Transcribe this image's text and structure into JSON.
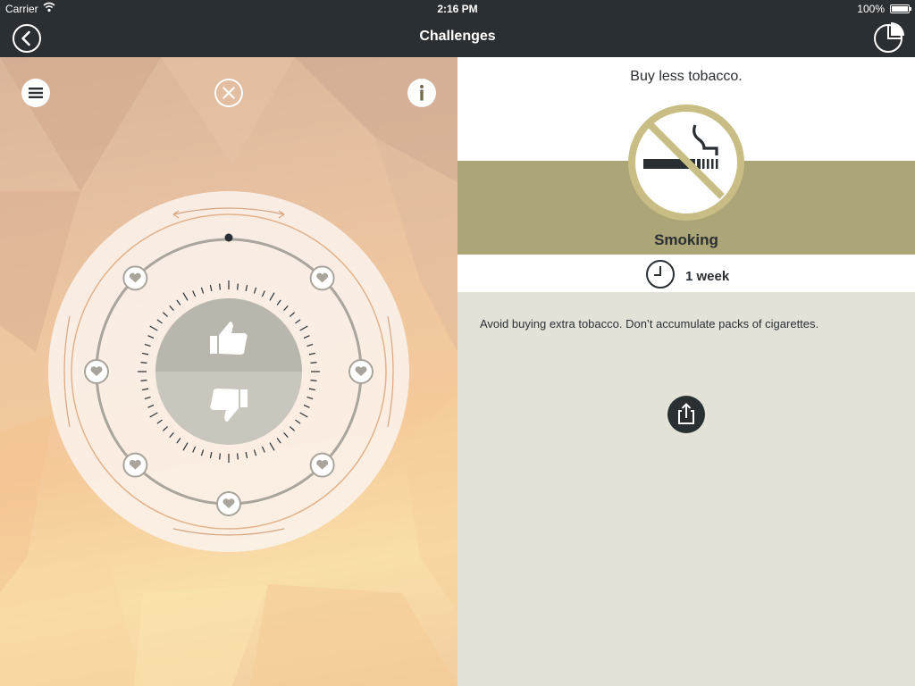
{
  "status_bar": {
    "carrier": "Carrier",
    "time": "2:16 PM",
    "battery": "100%"
  },
  "nav": {
    "title": "Challenges",
    "back_icon": "back-arrow-icon",
    "stats_icon": "pie-chart-icon"
  },
  "left_panel": {
    "menu_icon": "hamburger-menu-icon",
    "close_icon": "close-icon",
    "info_icon": "info-icon",
    "dial": {
      "like_icon": "thumbs-up-icon",
      "dislike_icon": "thumbs-down-icon",
      "heart_icon": "heart-icon"
    }
  },
  "challenge": {
    "title": "Buy less tobacco.",
    "category": "Smoking",
    "category_icon": "no-smoking-icon",
    "duration": "1 week",
    "duration_icon": "clock-icon",
    "description": "Avoid buying extra tobacco. Don’t accumulate packs of cigarettes.",
    "share_icon": "share-icon"
  },
  "colors": {
    "dark": "#2a2f33",
    "accent_olive": "#aca577",
    "panel_bg": "#e2e2d8",
    "badge_ring": "#c8bd84"
  }
}
